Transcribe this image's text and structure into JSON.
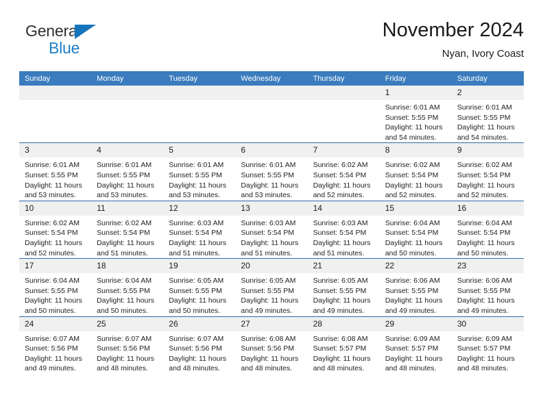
{
  "brand": {
    "name_part1": "General",
    "name_part2": "Blue",
    "accent_color": "#1f7fc4",
    "triangle_color": "#1574bb"
  },
  "header": {
    "title": "November 2024",
    "subtitle": "Nyan, Ivory Coast"
  },
  "theme": {
    "header_row_bg": "#3a7cbe",
    "daynum_bg": "#f0f0f0",
    "row_separator": "#2f6aa8"
  },
  "weekdays": [
    "Sunday",
    "Monday",
    "Tuesday",
    "Wednesday",
    "Thursday",
    "Friday",
    "Saturday"
  ],
  "weeks": [
    [
      {
        "day": "",
        "blank": true
      },
      {
        "day": "",
        "blank": true
      },
      {
        "day": "",
        "blank": true
      },
      {
        "day": "",
        "blank": true
      },
      {
        "day": "",
        "blank": true
      },
      {
        "day": "1",
        "sunrise": "Sunrise: 6:01 AM",
        "sunset": "Sunset: 5:55 PM",
        "daylight_line1": "Daylight: 11 hours",
        "daylight_line2": "and 54 minutes."
      },
      {
        "day": "2",
        "sunrise": "Sunrise: 6:01 AM",
        "sunset": "Sunset: 5:55 PM",
        "daylight_line1": "Daylight: 11 hours",
        "daylight_line2": "and 54 minutes."
      }
    ],
    [
      {
        "day": "3",
        "sunrise": "Sunrise: 6:01 AM",
        "sunset": "Sunset: 5:55 PM",
        "daylight_line1": "Daylight: 11 hours",
        "daylight_line2": "and 53 minutes."
      },
      {
        "day": "4",
        "sunrise": "Sunrise: 6:01 AM",
        "sunset": "Sunset: 5:55 PM",
        "daylight_line1": "Daylight: 11 hours",
        "daylight_line2": "and 53 minutes."
      },
      {
        "day": "5",
        "sunrise": "Sunrise: 6:01 AM",
        "sunset": "Sunset: 5:55 PM",
        "daylight_line1": "Daylight: 11 hours",
        "daylight_line2": "and 53 minutes."
      },
      {
        "day": "6",
        "sunrise": "Sunrise: 6:01 AM",
        "sunset": "Sunset: 5:55 PM",
        "daylight_line1": "Daylight: 11 hours",
        "daylight_line2": "and 53 minutes."
      },
      {
        "day": "7",
        "sunrise": "Sunrise: 6:02 AM",
        "sunset": "Sunset: 5:54 PM",
        "daylight_line1": "Daylight: 11 hours",
        "daylight_line2": "and 52 minutes."
      },
      {
        "day": "8",
        "sunrise": "Sunrise: 6:02 AM",
        "sunset": "Sunset: 5:54 PM",
        "daylight_line1": "Daylight: 11 hours",
        "daylight_line2": "and 52 minutes."
      },
      {
        "day": "9",
        "sunrise": "Sunrise: 6:02 AM",
        "sunset": "Sunset: 5:54 PM",
        "daylight_line1": "Daylight: 11 hours",
        "daylight_line2": "and 52 minutes."
      }
    ],
    [
      {
        "day": "10",
        "sunrise": "Sunrise: 6:02 AM",
        "sunset": "Sunset: 5:54 PM",
        "daylight_line1": "Daylight: 11 hours",
        "daylight_line2": "and 52 minutes."
      },
      {
        "day": "11",
        "sunrise": "Sunrise: 6:02 AM",
        "sunset": "Sunset: 5:54 PM",
        "daylight_line1": "Daylight: 11 hours",
        "daylight_line2": "and 51 minutes."
      },
      {
        "day": "12",
        "sunrise": "Sunrise: 6:03 AM",
        "sunset": "Sunset: 5:54 PM",
        "daylight_line1": "Daylight: 11 hours",
        "daylight_line2": "and 51 minutes."
      },
      {
        "day": "13",
        "sunrise": "Sunrise: 6:03 AM",
        "sunset": "Sunset: 5:54 PM",
        "daylight_line1": "Daylight: 11 hours",
        "daylight_line2": "and 51 minutes."
      },
      {
        "day": "14",
        "sunrise": "Sunrise: 6:03 AM",
        "sunset": "Sunset: 5:54 PM",
        "daylight_line1": "Daylight: 11 hours",
        "daylight_line2": "and 51 minutes."
      },
      {
        "day": "15",
        "sunrise": "Sunrise: 6:04 AM",
        "sunset": "Sunset: 5:54 PM",
        "daylight_line1": "Daylight: 11 hours",
        "daylight_line2": "and 50 minutes."
      },
      {
        "day": "16",
        "sunrise": "Sunrise: 6:04 AM",
        "sunset": "Sunset: 5:54 PM",
        "daylight_line1": "Daylight: 11 hours",
        "daylight_line2": "and 50 minutes."
      }
    ],
    [
      {
        "day": "17",
        "sunrise": "Sunrise: 6:04 AM",
        "sunset": "Sunset: 5:55 PM",
        "daylight_line1": "Daylight: 11 hours",
        "daylight_line2": "and 50 minutes."
      },
      {
        "day": "18",
        "sunrise": "Sunrise: 6:04 AM",
        "sunset": "Sunset: 5:55 PM",
        "daylight_line1": "Daylight: 11 hours",
        "daylight_line2": "and 50 minutes."
      },
      {
        "day": "19",
        "sunrise": "Sunrise: 6:05 AM",
        "sunset": "Sunset: 5:55 PM",
        "daylight_line1": "Daylight: 11 hours",
        "daylight_line2": "and 50 minutes."
      },
      {
        "day": "20",
        "sunrise": "Sunrise: 6:05 AM",
        "sunset": "Sunset: 5:55 PM",
        "daylight_line1": "Daylight: 11 hours",
        "daylight_line2": "and 49 minutes."
      },
      {
        "day": "21",
        "sunrise": "Sunrise: 6:05 AM",
        "sunset": "Sunset: 5:55 PM",
        "daylight_line1": "Daylight: 11 hours",
        "daylight_line2": "and 49 minutes."
      },
      {
        "day": "22",
        "sunrise": "Sunrise: 6:06 AM",
        "sunset": "Sunset: 5:55 PM",
        "daylight_line1": "Daylight: 11 hours",
        "daylight_line2": "and 49 minutes."
      },
      {
        "day": "23",
        "sunrise": "Sunrise: 6:06 AM",
        "sunset": "Sunset: 5:55 PM",
        "daylight_line1": "Daylight: 11 hours",
        "daylight_line2": "and 49 minutes."
      }
    ],
    [
      {
        "day": "24",
        "sunrise": "Sunrise: 6:07 AM",
        "sunset": "Sunset: 5:56 PM",
        "daylight_line1": "Daylight: 11 hours",
        "daylight_line2": "and 49 minutes."
      },
      {
        "day": "25",
        "sunrise": "Sunrise: 6:07 AM",
        "sunset": "Sunset: 5:56 PM",
        "daylight_line1": "Daylight: 11 hours",
        "daylight_line2": "and 48 minutes."
      },
      {
        "day": "26",
        "sunrise": "Sunrise: 6:07 AM",
        "sunset": "Sunset: 5:56 PM",
        "daylight_line1": "Daylight: 11 hours",
        "daylight_line2": "and 48 minutes."
      },
      {
        "day": "27",
        "sunrise": "Sunrise: 6:08 AM",
        "sunset": "Sunset: 5:56 PM",
        "daylight_line1": "Daylight: 11 hours",
        "daylight_line2": "and 48 minutes."
      },
      {
        "day": "28",
        "sunrise": "Sunrise: 6:08 AM",
        "sunset": "Sunset: 5:57 PM",
        "daylight_line1": "Daylight: 11 hours",
        "daylight_line2": "and 48 minutes."
      },
      {
        "day": "29",
        "sunrise": "Sunrise: 6:09 AM",
        "sunset": "Sunset: 5:57 PM",
        "daylight_line1": "Daylight: 11 hours",
        "daylight_line2": "and 48 minutes."
      },
      {
        "day": "30",
        "sunrise": "Sunrise: 6:09 AM",
        "sunset": "Sunset: 5:57 PM",
        "daylight_line1": "Daylight: 11 hours",
        "daylight_line2": "and 48 minutes."
      }
    ]
  ]
}
